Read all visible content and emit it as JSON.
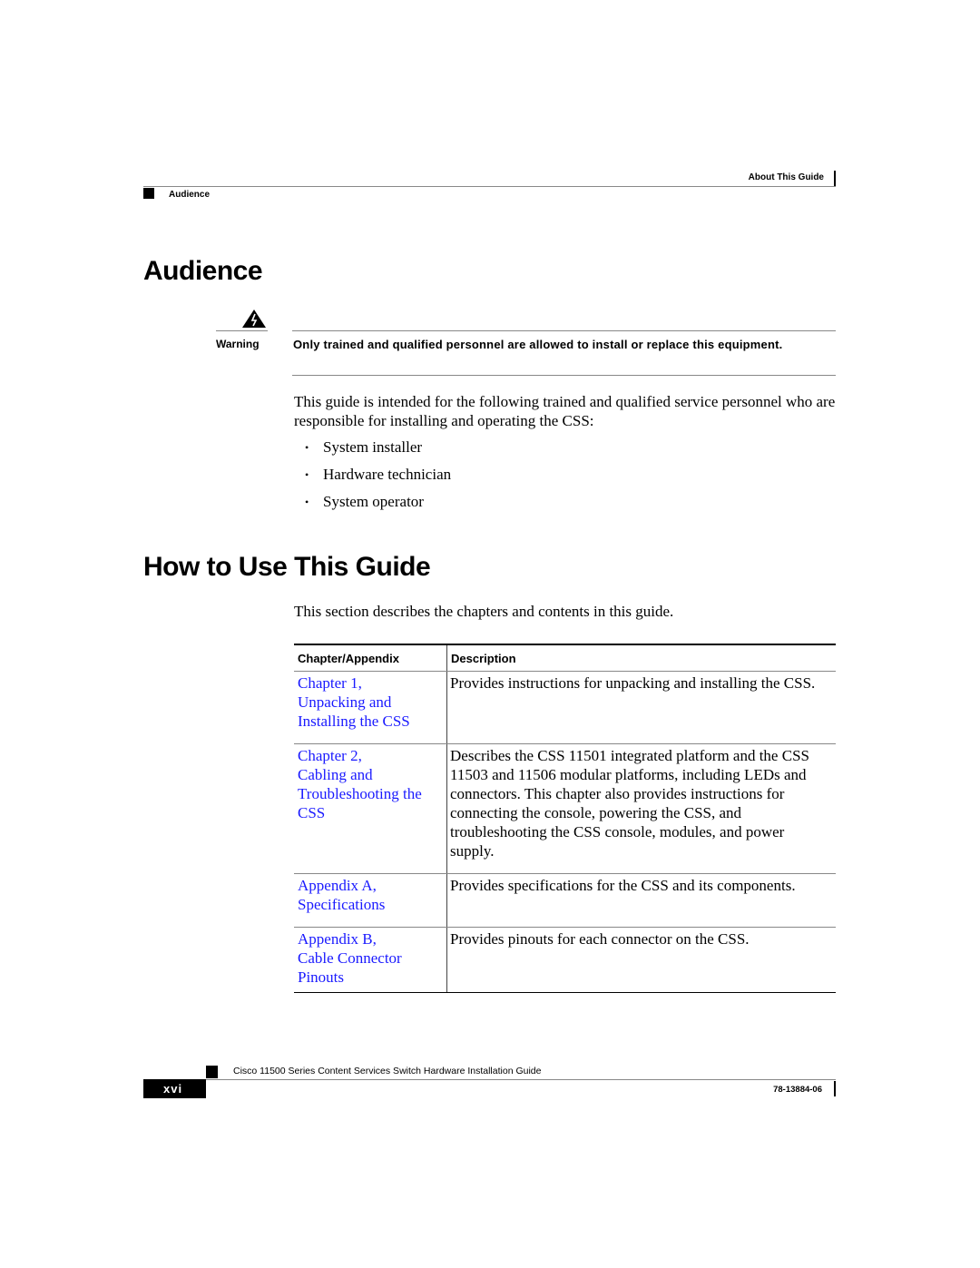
{
  "header": {
    "section": "About This Guide",
    "subsection": "Audience"
  },
  "audience": {
    "title": "Audience",
    "warning": {
      "icon": "warning-triangle-icon",
      "label": "Warning",
      "text": "Only trained and qualified personnel are allowed to install or replace this equipment."
    },
    "intro": "This guide is intended for the following trained and qualified service personnel who are responsible for installing and operating the CSS:",
    "bullet_glyph": "•",
    "bullets": [
      "System installer",
      "Hardware technician",
      "System operator"
    ]
  },
  "howto": {
    "title": "How to Use This Guide",
    "intro": "This section describes the chapters and contents in this guide.",
    "table": {
      "headers": [
        "Chapter/Appendix",
        "Description"
      ],
      "rows": [
        {
          "link_lines": [
            "Chapter 1,",
            "Unpacking and",
            "Installing the CSS"
          ],
          "description": "Provides instructions for unpacking and installing the CSS."
        },
        {
          "link_lines": [
            "Chapter 2,",
            "Cabling and",
            "Troubleshooting the",
            "CSS"
          ],
          "description": "Describes the CSS 11501 integrated platform and the CSS 11503 and 11506 modular platforms, including LEDs and connectors. This chapter also provides instructions for connecting the console, powering the CSS, and troubleshooting the CSS console, modules, and power supply."
        },
        {
          "link_lines": [
            "Appendix A,",
            "Specifications"
          ],
          "description": "Provides specifications for the CSS and its components."
        },
        {
          "link_lines": [
            "Appendix B,",
            "Cable Connector",
            "Pinouts"
          ],
          "description": "Provides pinouts for each connector on the CSS."
        }
      ]
    }
  },
  "colors": {
    "link": "#1a1aff",
    "text": "#000000",
    "rule": "#888888"
  },
  "footer": {
    "book_title": "Cisco 11500 Series Content Services Switch Hardware Installation Guide",
    "page_number": "xvi",
    "doc_number": "78-13884-06"
  }
}
